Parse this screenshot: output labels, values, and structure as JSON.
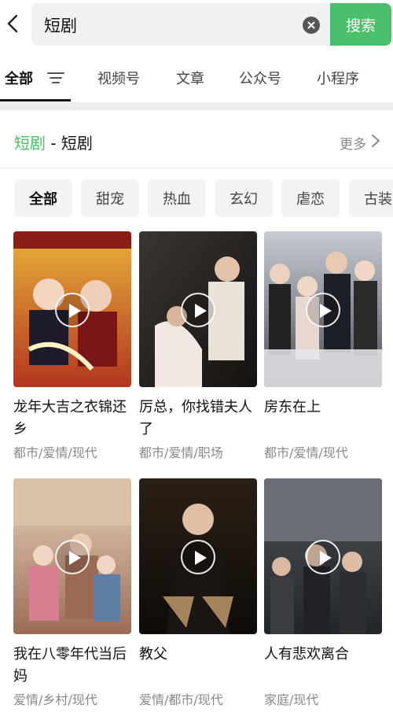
{
  "search": {
    "query": "短剧",
    "button_label": "搜索"
  },
  "tabs": [
    {
      "label": "全部",
      "active": true
    },
    {
      "label": "视频号"
    },
    {
      "label": "文章"
    },
    {
      "label": "公众号"
    },
    {
      "label": "小程序"
    }
  ],
  "section": {
    "title_green": "短剧",
    "title_rest": " - 短剧",
    "more_label": "更多"
  },
  "chips": [
    "全部",
    "甜宠",
    "热血",
    "玄幻",
    "虐恋",
    "古装"
  ],
  "dramas": [
    {
      "title": "龙年大吉之衣锦还乡",
      "tags": "都市/爱情/现代"
    },
    {
      "title": "厉总，你找错夫人了",
      "tags": "都市/爱情/职场"
    },
    {
      "title": "房东在上",
      "tags": "都市/爱情/现代"
    },
    {
      "title": "我在八零年代当后妈",
      "tags": "爱情/乡村/现代"
    },
    {
      "title": "教父",
      "tags": "爱情/都市/现代"
    },
    {
      "title": "人有悲欢离合",
      "tags": "家庭/现代"
    }
  ],
  "colors": {
    "accent": "#4cbf6a"
  },
  "icons": {
    "back": "chevron-left-icon",
    "clear": "close-circle-icon",
    "filter": "filter-icon",
    "play": "play-icon",
    "more": "chevron-right-icon"
  }
}
